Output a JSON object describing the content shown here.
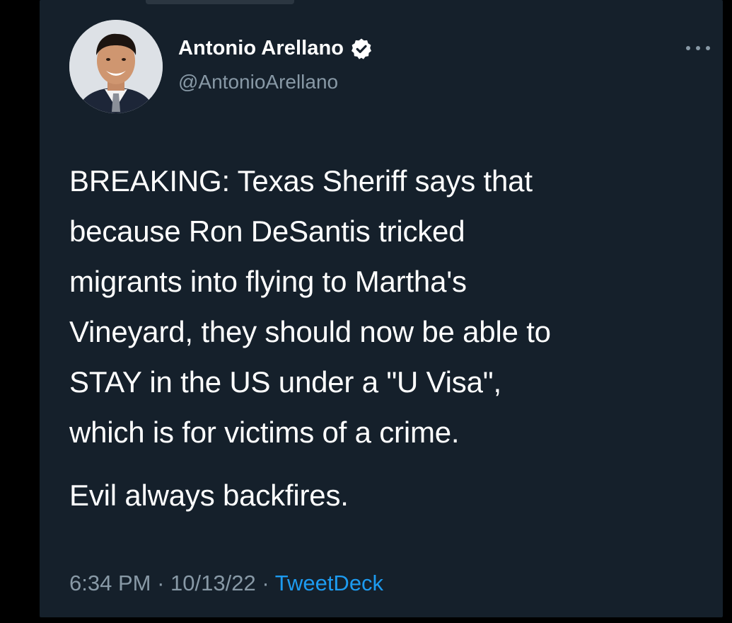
{
  "tweet": {
    "author": {
      "display_name": "Antonio Arellano",
      "handle": "@AntonioArellano",
      "verified": true
    },
    "text_paragraph_1": "BREAKING: Texas Sheriff says that\nbecause Ron DeSantis tricked\nmigrants into flying to Martha's\nVineyard, they should now be able to\nSTAY in the US under a \"U Visa\",\nwhich is for victims of a crime.",
    "text_paragraph_2": "Evil always backfires.",
    "time": "6:34 PM",
    "separator": "·",
    "date": "10/13/22",
    "source": "TweetDeck"
  },
  "colors": {
    "background": "#15202b",
    "text": "#ffffff",
    "secondary_text": "#8899a6",
    "link": "#1d9bf0"
  },
  "icons": {
    "verified": "verified-badge-icon",
    "more": "more-options-icon"
  }
}
